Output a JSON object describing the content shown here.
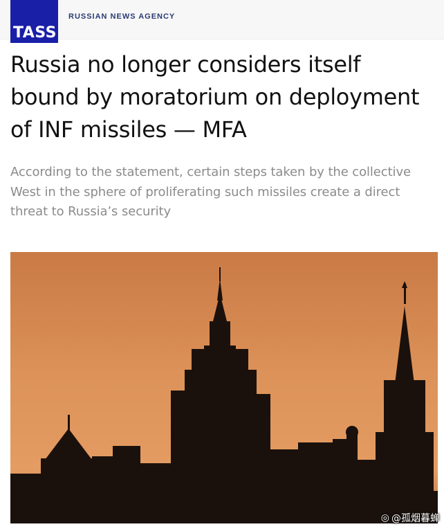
{
  "header": {
    "logo_text": "TASS",
    "agency_name": "RUSSIAN NEWS AGENCY",
    "brand_color": "#1a1fa8"
  },
  "article": {
    "title": "Russia no longer considers itself bound by moratorium on deployment of INF missiles — MFA",
    "lead": "According to the statement, certain steps taken by the collective West in the sphere of proliferating such missiles create a direct threat to Russia’s security"
  },
  "photo": {
    "subject": "Skyline silhouette at sunset with high-rise tower and Kremlin spire",
    "sky_color": "#d88a4e"
  },
  "watermark": {
    "icon": "weibo-icon",
    "text": "@孤烟暮蝉"
  }
}
